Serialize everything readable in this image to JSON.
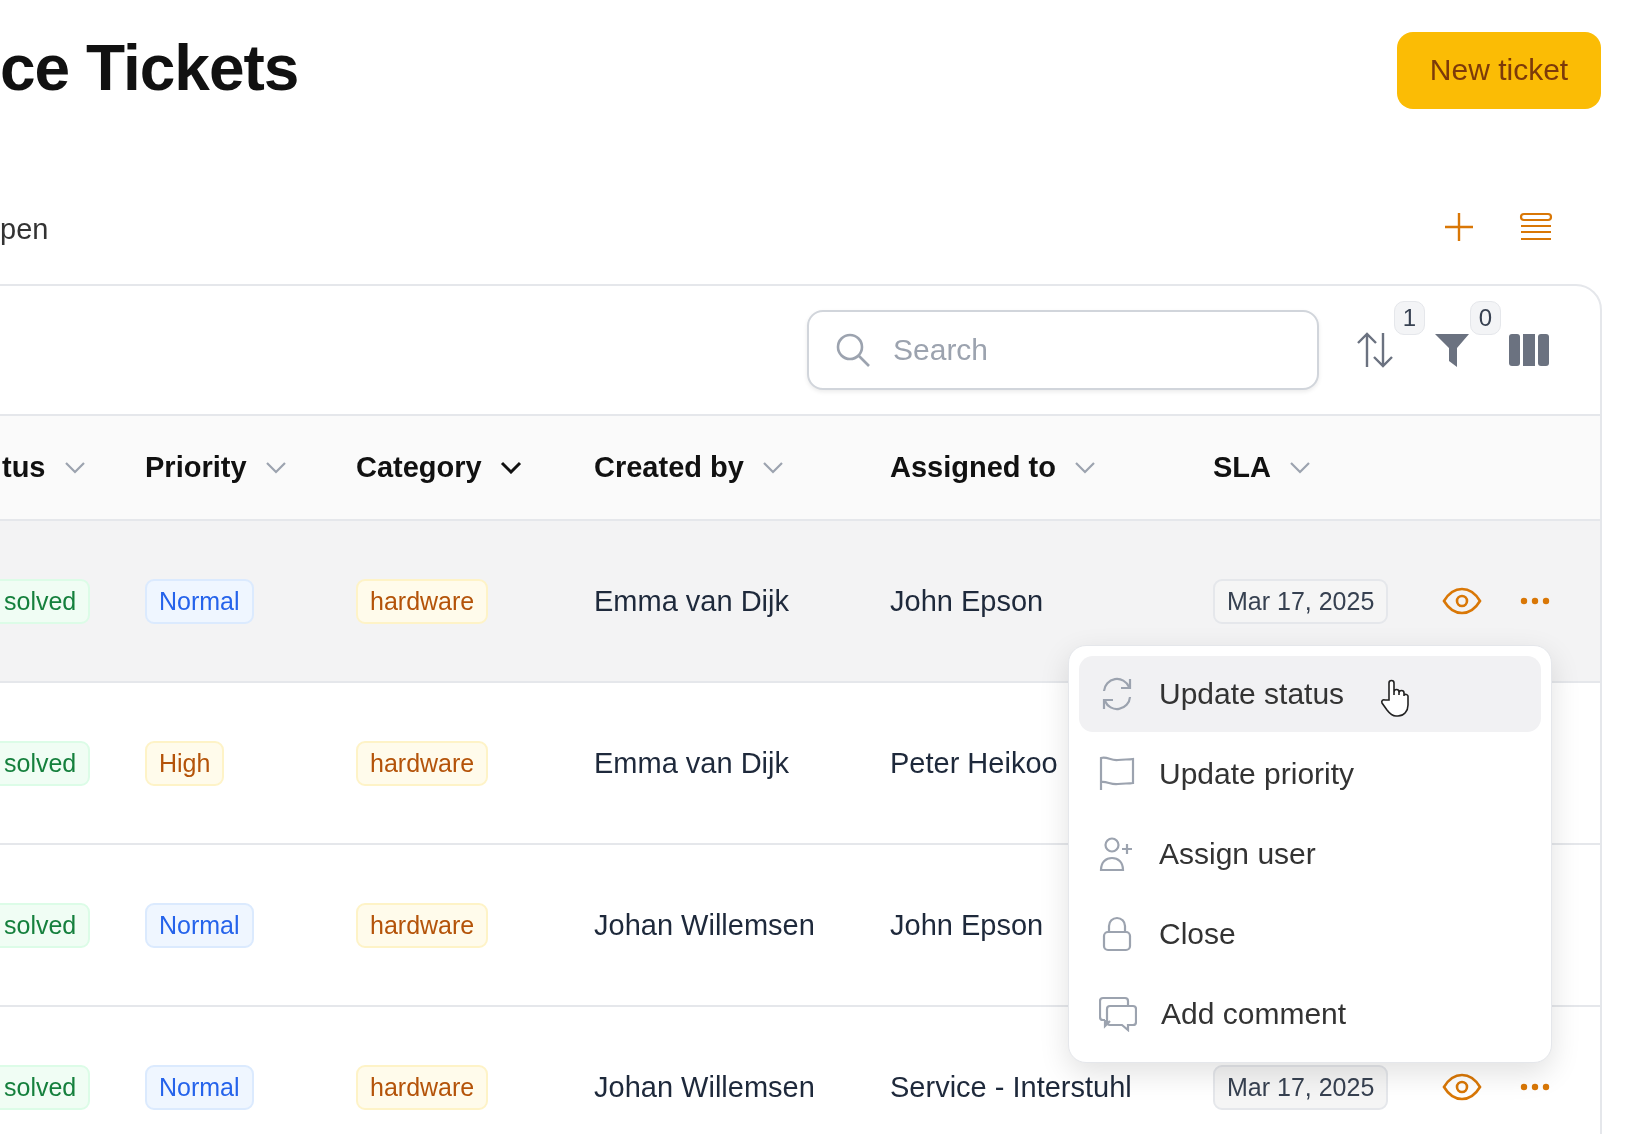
{
  "header": {
    "title": "ce Tickets",
    "new_button": "New ticket"
  },
  "view": {
    "label": "pen"
  },
  "toolbar": {
    "search": {
      "placeholder": "Search"
    },
    "sort_count": "1",
    "filter_count": "0"
  },
  "table": {
    "columns": [
      {
        "label": "tus",
        "sorted": false
      },
      {
        "label": "Priority",
        "sorted": false
      },
      {
        "label": "Category",
        "sorted": true
      },
      {
        "label": "Created by",
        "sorted": false
      },
      {
        "label": "Assigned to",
        "sorted": false
      },
      {
        "label": "SLA",
        "sorted": false
      }
    ],
    "rows": [
      {
        "status": "solved",
        "priority": {
          "label": "Normal",
          "kind": "normal"
        },
        "category": "hardware",
        "created_by": "Emma van Dijk",
        "assigned_to": "John Epson",
        "sla": "Mar 17, 2025",
        "hovered": true
      },
      {
        "status": "solved",
        "priority": {
          "label": "High",
          "kind": "high"
        },
        "category": "hardware",
        "created_by": "Emma van Dijk",
        "assigned_to": "Peter Heikoo",
        "hovered": false
      },
      {
        "status": "solved",
        "priority": {
          "label": "Normal",
          "kind": "normal"
        },
        "category": "hardware",
        "created_by": "Johan Willemsen",
        "assigned_to": "John Epson",
        "hovered": false
      },
      {
        "status": "solved",
        "priority": {
          "label": "Normal",
          "kind": "normal"
        },
        "category": "hardware",
        "created_by": "Johan Willemsen",
        "assigned_to": "Service - Interstuhl",
        "sla": "Mar 17, 2025",
        "hovered": false
      }
    ]
  },
  "menu": {
    "items": [
      {
        "label": "Update status",
        "kind": "refresh",
        "hovered": true
      },
      {
        "label": "Update priority",
        "kind": "flag",
        "hovered": false
      },
      {
        "label": "Assign user",
        "kind": "user-plus",
        "hovered": false
      },
      {
        "label": "Close",
        "kind": "lock",
        "hovered": false
      },
      {
        "label": "Add comment",
        "kind": "comments",
        "hovered": false
      }
    ]
  }
}
